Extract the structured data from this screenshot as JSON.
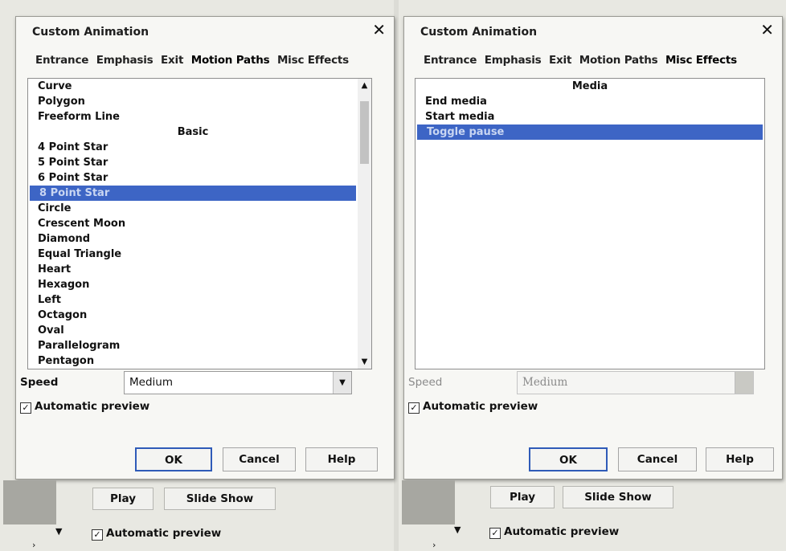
{
  "dialog_left": {
    "title": "Custom Animation",
    "close_glyph": "✕",
    "tabs": [
      "Entrance",
      "Emphasis",
      "Exit",
      "Motion Paths",
      "Misc Effects"
    ],
    "active_tab": "Motion Paths",
    "list_items": [
      {
        "label": "Curve"
      },
      {
        "label": "Polygon"
      },
      {
        "label": "Freeform Line"
      },
      {
        "label": "Basic",
        "header": true
      },
      {
        "label": "4 Point Star"
      },
      {
        "label": "5 Point Star"
      },
      {
        "label": "6 Point Star"
      },
      {
        "label": "8 Point Star",
        "selected": true
      },
      {
        "label": "Circle"
      },
      {
        "label": "Crescent Moon"
      },
      {
        "label": "Diamond"
      },
      {
        "label": "Equal Triangle"
      },
      {
        "label": "Heart"
      },
      {
        "label": "Hexagon"
      },
      {
        "label": "Left"
      },
      {
        "label": "Octagon"
      },
      {
        "label": "Oval"
      },
      {
        "label": "Parallelogram"
      },
      {
        "label": "Pentagon"
      }
    ],
    "speed_label": "Speed",
    "speed_value": "Medium",
    "auto_preview_label": "Automatic preview",
    "ok_label": "OK",
    "cancel_label": "Cancel",
    "help_label": "Help"
  },
  "dialog_right": {
    "title": "Custom Animation",
    "close_glyph": "✕",
    "tabs": [
      "Entrance",
      "Emphasis",
      "Exit",
      "Motion Paths",
      "Misc Effects"
    ],
    "active_tab": "Misc Effects",
    "list_items": [
      {
        "label": "Media",
        "header": true
      },
      {
        "label": "End media"
      },
      {
        "label": "Start media"
      },
      {
        "label": "Toggle pause",
        "selected": true
      }
    ],
    "speed_label": "Speed",
    "speed_value": "Medium",
    "speed_disabled": true,
    "auto_preview_label": "Automatic preview",
    "ok_label": "OK",
    "cancel_label": "Cancel",
    "help_label": "Help"
  },
  "bottom_strip": {
    "play_label": "Play",
    "slide_show_label": "Slide Show",
    "auto_preview_label": "Automatic preview"
  },
  "colors": {
    "selection": "#3d65c5",
    "default_button_border": "#2f5bb8",
    "dialog_bg": "#f7f7f4"
  }
}
